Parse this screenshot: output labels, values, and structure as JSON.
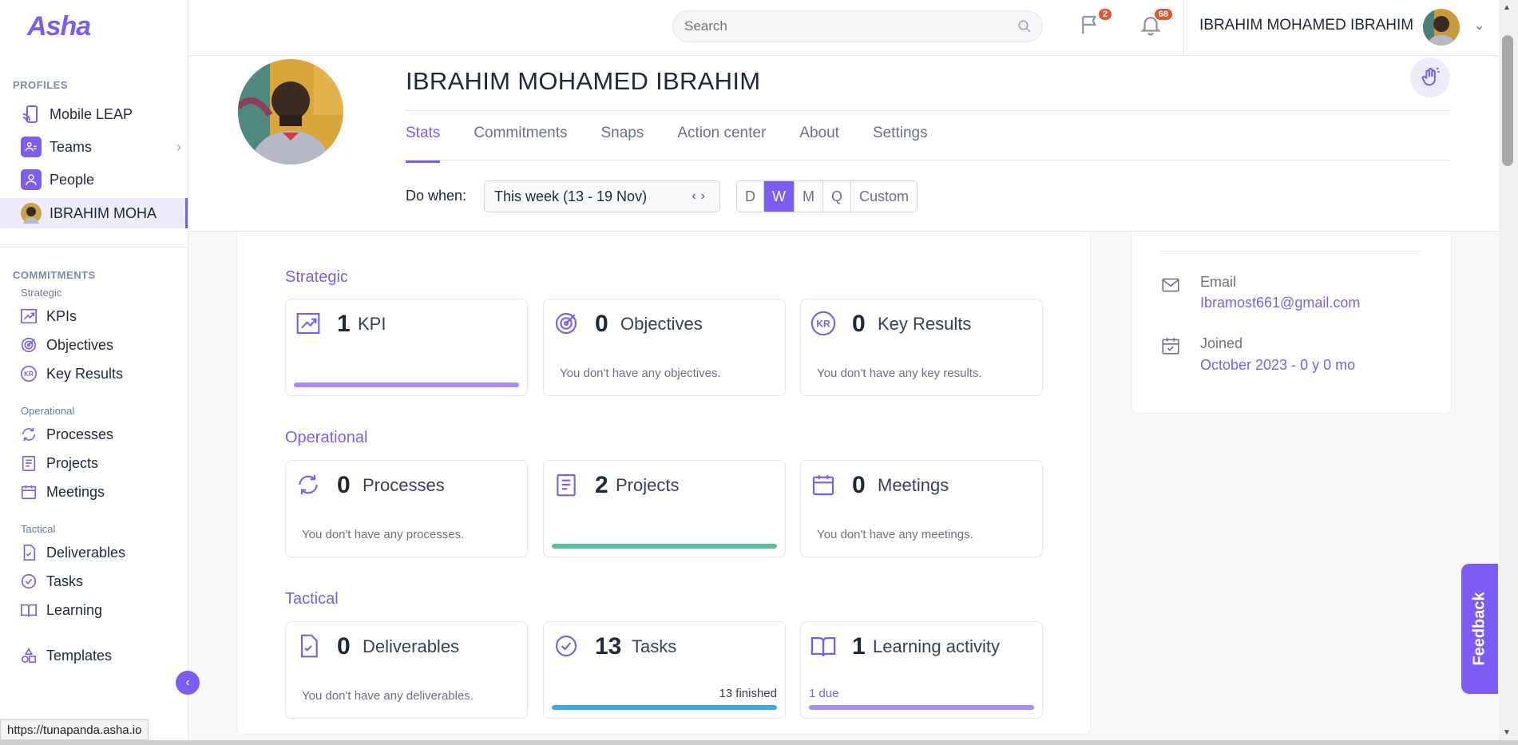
{
  "app": {
    "logo": "Asha"
  },
  "topbar": {
    "search_placeholder": "Search",
    "flag_badge": "2",
    "notif_badge": "68",
    "user_name": "IBRAHIM MOHAMED IBRAHIM"
  },
  "sidebar": {
    "profiles_title": "PROFILES",
    "profiles": [
      {
        "label": "Mobile LEAP",
        "icon": "mobile-cast-icon"
      },
      {
        "label": "Teams",
        "icon": "teams-icon"
      },
      {
        "label": "People",
        "icon": "person-icon"
      },
      {
        "label": "IBRAHIM MOHA",
        "icon": "avatar"
      }
    ],
    "commitments_title": "COMMITMENTS",
    "strategic_title": "Strategic",
    "strategic": [
      {
        "label": "KPIs",
        "icon": "chart-up-icon"
      },
      {
        "label": "Objectives",
        "icon": "target-icon"
      },
      {
        "label": "Key Results",
        "icon": "kr-icon"
      }
    ],
    "operational_title": "Operational",
    "operational": [
      {
        "label": "Processes",
        "icon": "cycle-icon"
      },
      {
        "label": "Projects",
        "icon": "clipboard-icon"
      },
      {
        "label": "Meetings",
        "icon": "calendar-icon"
      }
    ],
    "tactical_title": "Tactical",
    "tactical": [
      {
        "label": "Deliverables",
        "icon": "file-check-icon"
      },
      {
        "label": "Tasks",
        "icon": "check-circle-icon"
      },
      {
        "label": "Learning",
        "icon": "book-icon"
      }
    ],
    "templates": {
      "label": "Templates",
      "icon": "shapes-icon"
    }
  },
  "profile": {
    "name": "IBRAHIM MOHAMED IBRAHIM",
    "tabs": [
      "Stats",
      "Commitments",
      "Snaps",
      "Action center",
      "About",
      "Settings"
    ],
    "active_tab": "Stats",
    "do_when_label": "Do when:",
    "week_value": "This week (13 - 19 Nov)",
    "periods": [
      "D",
      "W",
      "M",
      "Q",
      "Custom"
    ],
    "active_period": "W"
  },
  "stats": {
    "strategic_title": "Strategic",
    "operational_title": "Operational",
    "tactical_title": "Tactical",
    "kpi": {
      "count": "1",
      "label": "KPI",
      "progress": 1.0,
      "bar_color": "#a78bfa"
    },
    "objectives": {
      "count": "0",
      "label": "Objectives",
      "empty": "You don't have any objectives."
    },
    "key_results": {
      "count": "0",
      "label": "Key Results",
      "empty": "You don't have any key results."
    },
    "processes": {
      "count": "0",
      "label": "Processes",
      "empty": "You don't have any processes."
    },
    "projects": {
      "count": "2",
      "label": "Projects",
      "progress": 1.0,
      "bar_color": "#4fc3a1"
    },
    "meetings": {
      "count": "0",
      "label": "Meetings",
      "empty": "You don't have any meetings."
    },
    "deliverables": {
      "count": "0",
      "label": "Deliverables",
      "empty": "You don't have any deliverables."
    },
    "tasks": {
      "count": "13",
      "label": "Tasks",
      "note": "13 finished",
      "progress": 1.0,
      "bar_color": "#38a9e4"
    },
    "learning": {
      "count": "1",
      "label": "Learning activity",
      "note": "1 due",
      "progress": 1.0,
      "bar_color": "#a78bfa"
    }
  },
  "info": {
    "email_label": "Email",
    "email_value": "Ibramost661@gmail.com",
    "joined_label": "Joined",
    "joined_value": "October 2023 - 0 y 0 mo"
  },
  "feedback_label": "Feedback",
  "status_url": "https://tunapanda.asha.io",
  "colors": {
    "accent": "#7c5cf5",
    "badge": "#e4572e"
  }
}
